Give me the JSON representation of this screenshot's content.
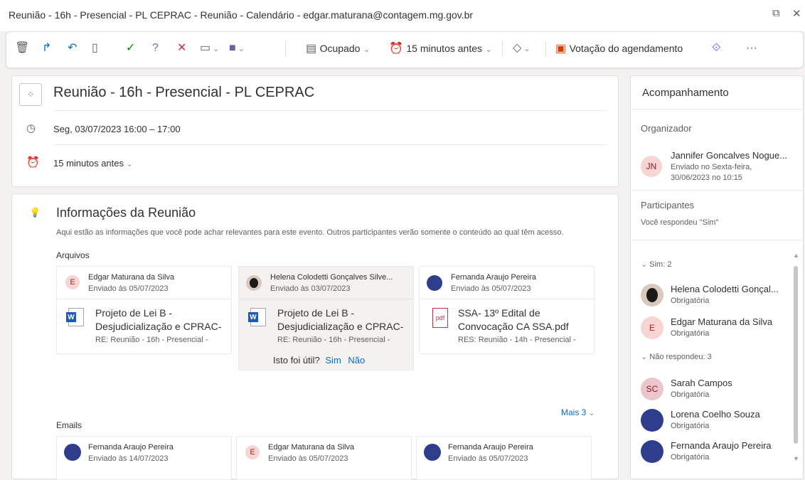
{
  "window": {
    "title": "Reunião - 16h - Presencial - PL CEPRAC - Reunião - Calendário - edgar.maturana@contagem.mg.gov.br"
  },
  "toolbar": {
    "show_as": "Ocupado",
    "reminder": "15 minutos antes",
    "poll_label": "Votação do agendamento",
    "more": "···",
    "icons": [
      "delete-icon",
      "forward-icon",
      "reply-icon",
      "copy-icon",
      "accept-icon",
      "tentative-icon",
      "decline-icon",
      "propose-time-icon",
      "teams-icon",
      "busy-icon",
      "reminder-icon",
      "tag-icon",
      "poll-icon",
      "loop-icon",
      "more-icon"
    ]
  },
  "event": {
    "title": "Reunião - 16h - Presencial - PL CEPRAC",
    "datetime": "Seg, 03/07/2023 16:00 – 17:00",
    "reminder": "15 minutos antes"
  },
  "insights": {
    "title": "Informações da Reunião",
    "description": "Aqui estão as informações que você pode achar relevantes para este evento. Outros participantes verão somente o conteúdo ao qual têm acesso.",
    "files_heading": "Arquivos",
    "files": [
      {
        "sender": "Edgar Maturana da Silva",
        "avatar": "E",
        "sent": "Enviado às 05/07/2023",
        "name_line1": "Projeto de Lei B -",
        "name_line2": "Desjudicialização e CPRAC-",
        "subject": "RE: Reunião - 16h - Presencial -",
        "type": "word"
      },
      {
        "sender": "Helena Colodetti Gonçalves Silve...",
        "avatar": "",
        "sent": "Enviado às 03/07/2023",
        "name_line1": "Projeto de Lei B -",
        "name_line2": "Desjudicialização e CPRAC-",
        "subject": "RE: Reunião - 16h - Presencial -",
        "type": "word"
      },
      {
        "sender": "Fernanda Araujo Pereira",
        "avatar": "",
        "sent": "Enviado às 05/07/2023",
        "name_line1": "SSA- 13º Edital de",
        "name_line2": "Convocação CA SSA.pdf",
        "subject": "RES: Reunião - 14h - Presencial -",
        "type": "pdf"
      }
    ],
    "feedback_question": "Isto foi útil?",
    "feedback_yes": "Sim",
    "feedback_no": "Não",
    "more_label": "Mais 3",
    "emails_heading": "Emails",
    "emails": [
      {
        "sender": "Fernanda Araujo Pereira",
        "avatar": "",
        "sent": "Enviado às 14/07/2023"
      },
      {
        "sender": "Edgar Maturana da Silva",
        "avatar": "E",
        "sent": "Enviado às 05/07/2023"
      },
      {
        "sender": "Fernanda Araujo Pereira",
        "avatar": "",
        "sent": "Enviado às 05/07/2023"
      }
    ]
  },
  "tracking": {
    "title": "Acompanhamento",
    "organizer_heading": "Organizador",
    "organizer": {
      "name": "Jannifer Goncalves Nogue...",
      "initials": "JN",
      "sent_line1": "Enviado no Sexta-feira,",
      "sent_line2": "30/06/2023 no 10:15"
    },
    "participants_heading": "Participantes",
    "response": "Você respondeu \"Sim\"",
    "yes_group": "Sim: 2",
    "yes_people": [
      {
        "name": "Helena Colodetti Gonçal...",
        "role": "Obrigatória",
        "initials": ""
      },
      {
        "name": "Edgar Maturana da Silva",
        "role": "Obrigatória",
        "initials": "E"
      }
    ],
    "noresp_group": "Não respondeu: 3",
    "noresp_people": [
      {
        "name": "Sarah Campos",
        "role": "Obrigatória",
        "initials": "SC"
      },
      {
        "name": "Lorena Coelho Souza",
        "role": "Obrigatória",
        "initials": ""
      },
      {
        "name": "Fernanda Araujo Pereira",
        "role": "Obrigatória",
        "initials": ""
      }
    ]
  }
}
